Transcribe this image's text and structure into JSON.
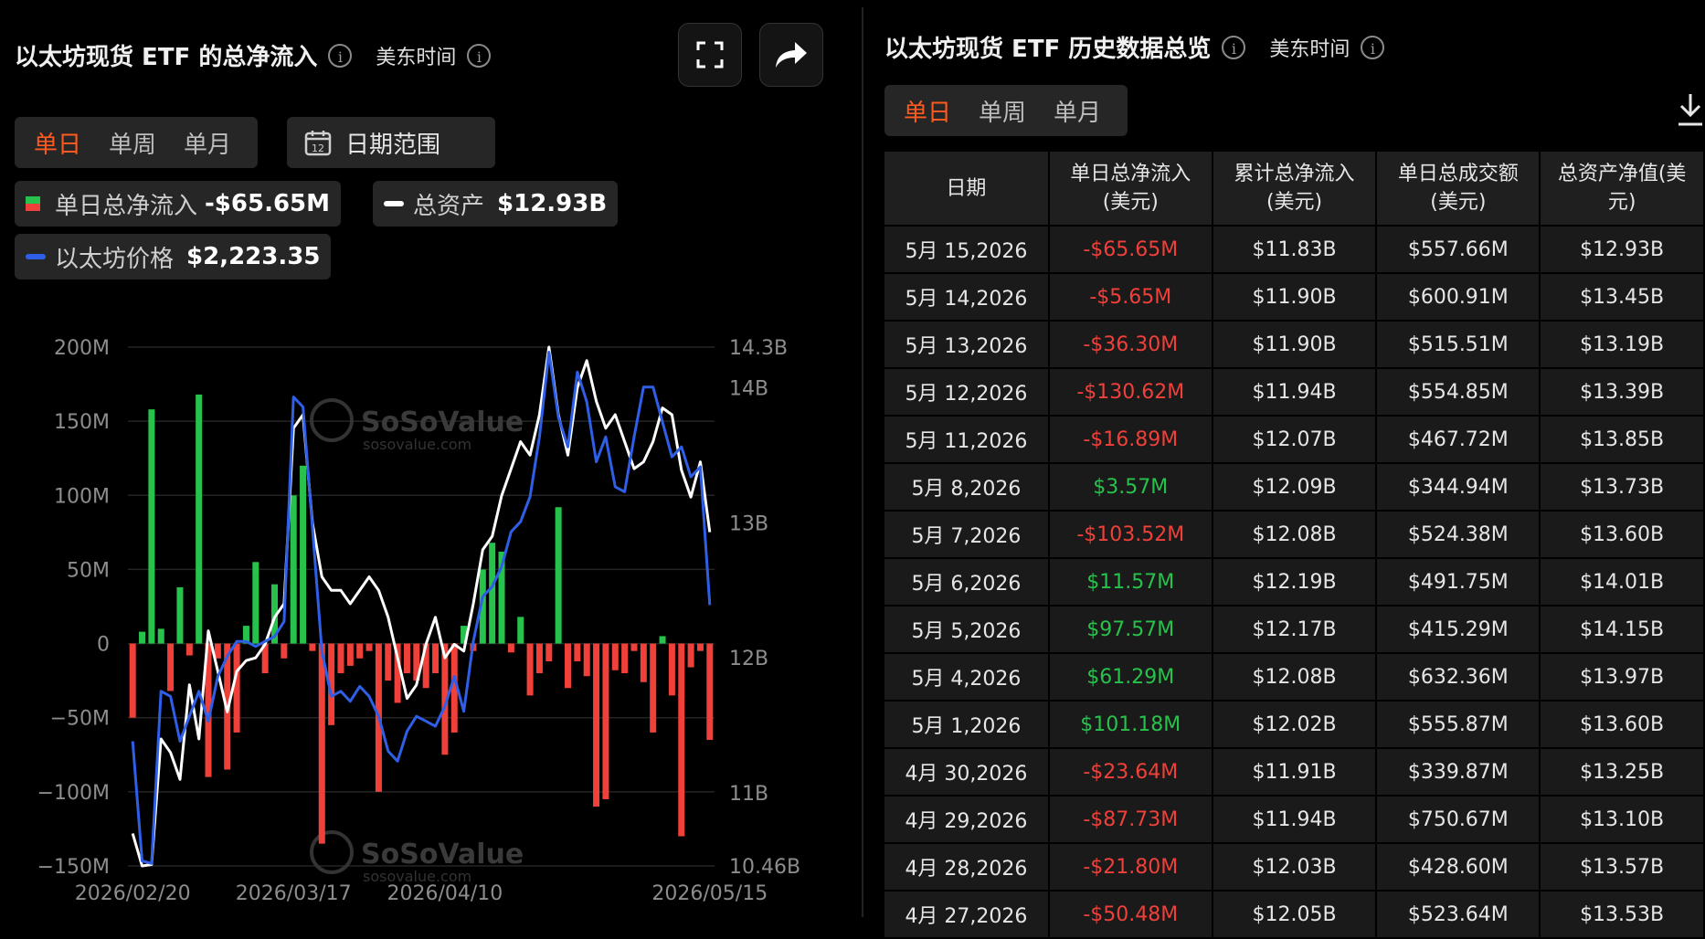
{
  "left": {
    "title": "以太坊现货 ETF 的总净流入",
    "timezone": "美东时间",
    "tabs": [
      "单日",
      "单周",
      "单月"
    ],
    "date_range_label": "日期范围",
    "calendar_day": "12",
    "legend": {
      "flow_label": "单日总净流入",
      "flow_value": "-$65.65M",
      "assets_label": "总资产",
      "assets_value": "$12.93B",
      "price_label": "以太坊价格",
      "price_value": "$2,223.35"
    }
  },
  "right": {
    "title": "以太坊现货 ETF 历史数据总览",
    "timezone": "美东时间",
    "tabs": [
      "单日",
      "单周",
      "单月"
    ],
    "headers": [
      "日期",
      "单日总净流入\n(美元)",
      "累计总净流入\n(美元)",
      "单日总成交额\n(美元)",
      "总资产净值(美\n元)"
    ],
    "rows": [
      [
        "5月 15,2026",
        "-$65.65M",
        "$11.83B",
        "$557.66M",
        "$12.93B"
      ],
      [
        "5月 14,2026",
        "-$5.65M",
        "$11.90B",
        "$600.91M",
        "$13.45B"
      ],
      [
        "5月 13,2026",
        "-$36.30M",
        "$11.90B",
        "$515.51M",
        "$13.19B"
      ],
      [
        "5月 12,2026",
        "-$130.62M",
        "$11.94B",
        "$554.85M",
        "$13.39B"
      ],
      [
        "5月 11,2026",
        "-$16.89M",
        "$12.07B",
        "$467.72M",
        "$13.85B"
      ],
      [
        "5月 8,2026",
        "$3.57M",
        "$12.09B",
        "$344.94M",
        "$13.73B"
      ],
      [
        "5月 7,2026",
        "-$103.52M",
        "$12.08B",
        "$524.38M",
        "$13.60B"
      ],
      [
        "5月 6,2026",
        "$11.57M",
        "$12.19B",
        "$491.75M",
        "$14.01B"
      ],
      [
        "5月 5,2026",
        "$97.57M",
        "$12.17B",
        "$415.29M",
        "$14.15B"
      ],
      [
        "5月 4,2026",
        "$61.29M",
        "$12.08B",
        "$632.36M",
        "$13.97B"
      ],
      [
        "5月 1,2026",
        "$101.18M",
        "$12.02B",
        "$555.87M",
        "$13.60B"
      ],
      [
        "4月 30,2026",
        "-$23.64M",
        "$11.91B",
        "$339.87M",
        "$13.25B"
      ],
      [
        "4月 29,2026",
        "-$87.73M",
        "$11.94B",
        "$750.67M",
        "$13.10B"
      ],
      [
        "4月 28,2026",
        "-$21.80M",
        "$12.03B",
        "$428.60M",
        "$13.57B"
      ],
      [
        "4月 27,2026",
        "-$50.48M",
        "$12.05B",
        "$523.64M",
        "$13.53B"
      ]
    ]
  },
  "watermark": {
    "brand": "SoSoValue",
    "site": "sosovalue.com"
  },
  "colors": {
    "positive": "#27c24c",
    "negative": "#f0403a",
    "price_line": "#2f5fe6",
    "assets_line": "#ffffff",
    "accent": "#ff5a1f"
  },
  "chart_data": {
    "type": "bar",
    "x_tick_labels": [
      "2026/02/20",
      "2026/03/17",
      "2026/04/10",
      "2026/05/15"
    ],
    "left_axis": {
      "ticks": [
        "200M",
        "150M",
        "100M",
        "50M",
        "0",
        "−50M",
        "−100M",
        "−150M"
      ],
      "range_musd": [
        -150,
        200
      ]
    },
    "right_axis": {
      "ticks": [
        "14.3B",
        "14B",
        "13B",
        "12B",
        "11B",
        "10.46B"
      ],
      "range_busd": [
        10.46,
        14.3
      ]
    },
    "series": [
      {
        "name": "单日总净流入",
        "type": "bar",
        "values": [
          -50,
          8,
          158,
          10,
          -32,
          38,
          -8,
          168,
          -90,
          -10,
          -85,
          -60,
          12,
          55,
          -20,
          40,
          -10,
          100,
          120,
          -5,
          -135,
          -55,
          -20,
          -15,
          -10,
          -5,
          -100,
          -25,
          -40,
          -20,
          -25,
          -30,
          -20,
          -75,
          -60,
          12,
          -5,
          50,
          68,
          62,
          -6,
          18,
          -35,
          -20,
          -12,
          92,
          -30,
          -12,
          -22,
          -110,
          -105,
          -18,
          -20,
          -5,
          -26,
          -60,
          5,
          -35,
          -130,
          -16,
          -5,
          -65
        ]
      },
      {
        "name": "总资产",
        "type": "line",
        "values": [
          10.7,
          10.46,
          10.47,
          11.4,
          11.3,
          11.1,
          11.8,
          11.4,
          12.2,
          11.9,
          11.6,
          11.9,
          11.98,
          12.0,
          12.1,
          12.3,
          12.4,
          13.7,
          13.8,
          13.0,
          12.6,
          12.5,
          12.5,
          12.4,
          12.5,
          12.6,
          12.5,
          12.3,
          12.0,
          11.7,
          11.8,
          12.1,
          12.3,
          12.0,
          12.1,
          12.05,
          12.4,
          12.8,
          12.9,
          13.2,
          13.4,
          13.6,
          13.5,
          13.8,
          14.3,
          13.8,
          13.5,
          14.0,
          14.2,
          13.9,
          13.7,
          13.8,
          13.6,
          13.4,
          13.45,
          13.6,
          13.85,
          13.8,
          13.39,
          13.19,
          13.45,
          12.93
        ]
      },
      {
        "name": "以太坊价格",
        "type": "line",
        "values": [
          1950,
          1710,
          1705,
          2050,
          2040,
          1950,
          2000,
          2050,
          1990,
          2080,
          2120,
          2150,
          2150,
          2140,
          2150,
          2160,
          2190,
          2640,
          2620,
          2380,
          2130,
          2040,
          2050,
          2030,
          2060,
          2040,
          2000,
          1930,
          1910,
          1970,
          2000,
          1990,
          1980,
          2020,
          2080,
          2010,
          2150,
          2240,
          2260,
          2300,
          2370,
          2390,
          2440,
          2560,
          2730,
          2600,
          2540,
          2690,
          2630,
          2510,
          2560,
          2460,
          2450,
          2560,
          2660,
          2660,
          2590,
          2520,
          2540,
          2480,
          2500,
          2223
        ]
      }
    ]
  }
}
